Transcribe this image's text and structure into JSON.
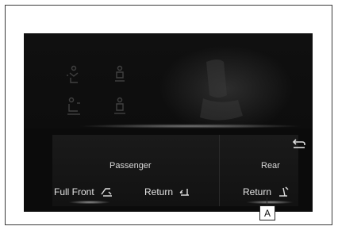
{
  "screen": {
    "panel": {
      "passenger_label": "Passenger",
      "rear_label": "Rear"
    },
    "buttons": {
      "full_front": "Full Front",
      "return_passenger": "Return",
      "return_rear": "Return"
    },
    "icons": {
      "back": "return-arrow-icon",
      "full_front": "seat-forward-icon",
      "return_passenger": "seat-return-icon",
      "return_rear": "seat-recline-icon"
    }
  },
  "callout": {
    "label": "A"
  }
}
